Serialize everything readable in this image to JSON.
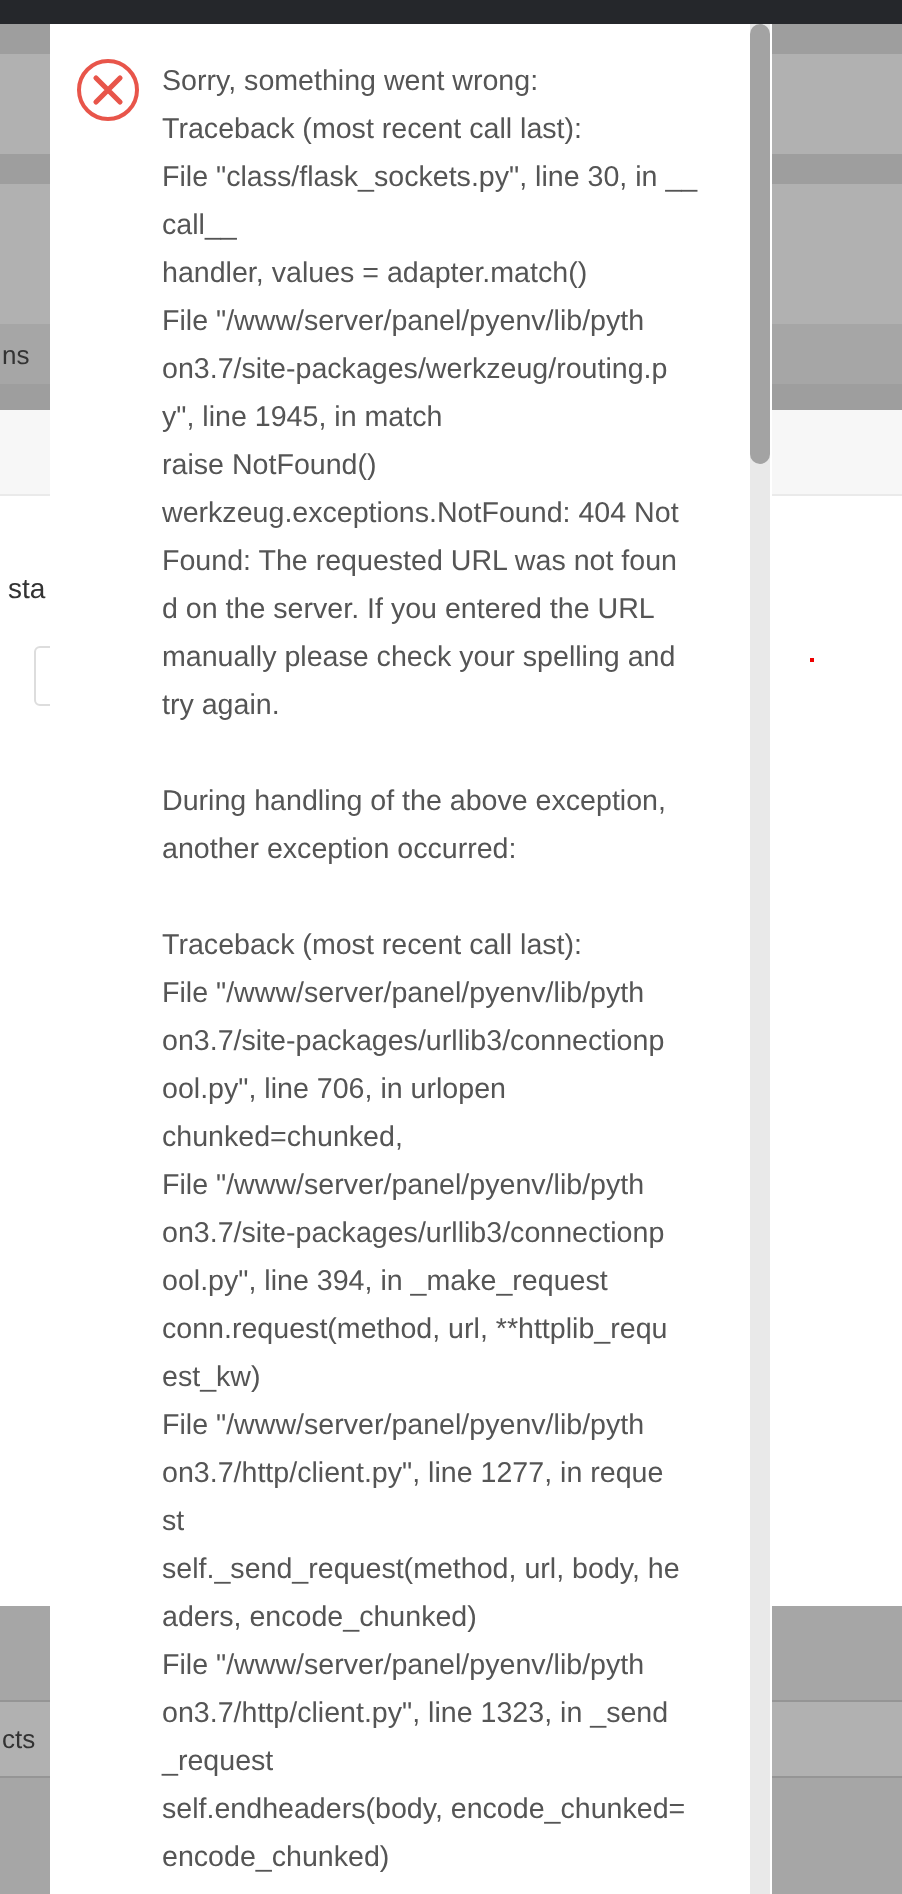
{
  "background": {
    "tab_fragment": "ns",
    "label_fragment": "sta",
    "row_fragment": "cts"
  },
  "dialog": {
    "kind": "error",
    "paragraphs": [
      [
        "Sorry, something went wrong:",
        "Traceback (most recent call last):",
        "File \"class/flask_sockets.py\", line 30, in __",
        "call__",
        "handler, values = adapter.match()",
        "File \"/www/server/panel/pyenv/lib/pyth",
        "on3.7/site-packages/werkzeug/routing.p",
        "y\", line 1945, in match",
        "raise NotFound()",
        "werkzeug.exceptions.NotFound: 404 Not",
        "Found: The requested URL was not foun",
        "d on the server. If you entered the URL",
        "manually please check your spelling and",
        "try again."
      ],
      [
        "During handling of the above exception,",
        "another exception occurred:"
      ],
      [
        "Traceback (most recent call last):",
        "File \"/www/server/panel/pyenv/lib/pyth",
        "on3.7/site-packages/urllib3/connectionp",
        "ool.py\", line 706, in urlopen",
        "chunked=chunked,",
        "File \"/www/server/panel/pyenv/lib/pyth",
        "on3.7/site-packages/urllib3/connectionp",
        "ool.py\", line 394, in _make_request",
        "conn.request(method, url, **httplib_requ",
        "est_kw)",
        "File \"/www/server/panel/pyenv/lib/pyth",
        "on3.7/http/client.py\", line 1277, in reque",
        "st",
        "self._send_request(method, url, body, he",
        "aders, encode_chunked)",
        "File \"/www/server/panel/pyenv/lib/pyth",
        "on3.7/http/client.py\", line 1323, in _send",
        "_request",
        "self.endheaders(body, encode_chunked=",
        "encode_chunked)"
      ]
    ]
  }
}
